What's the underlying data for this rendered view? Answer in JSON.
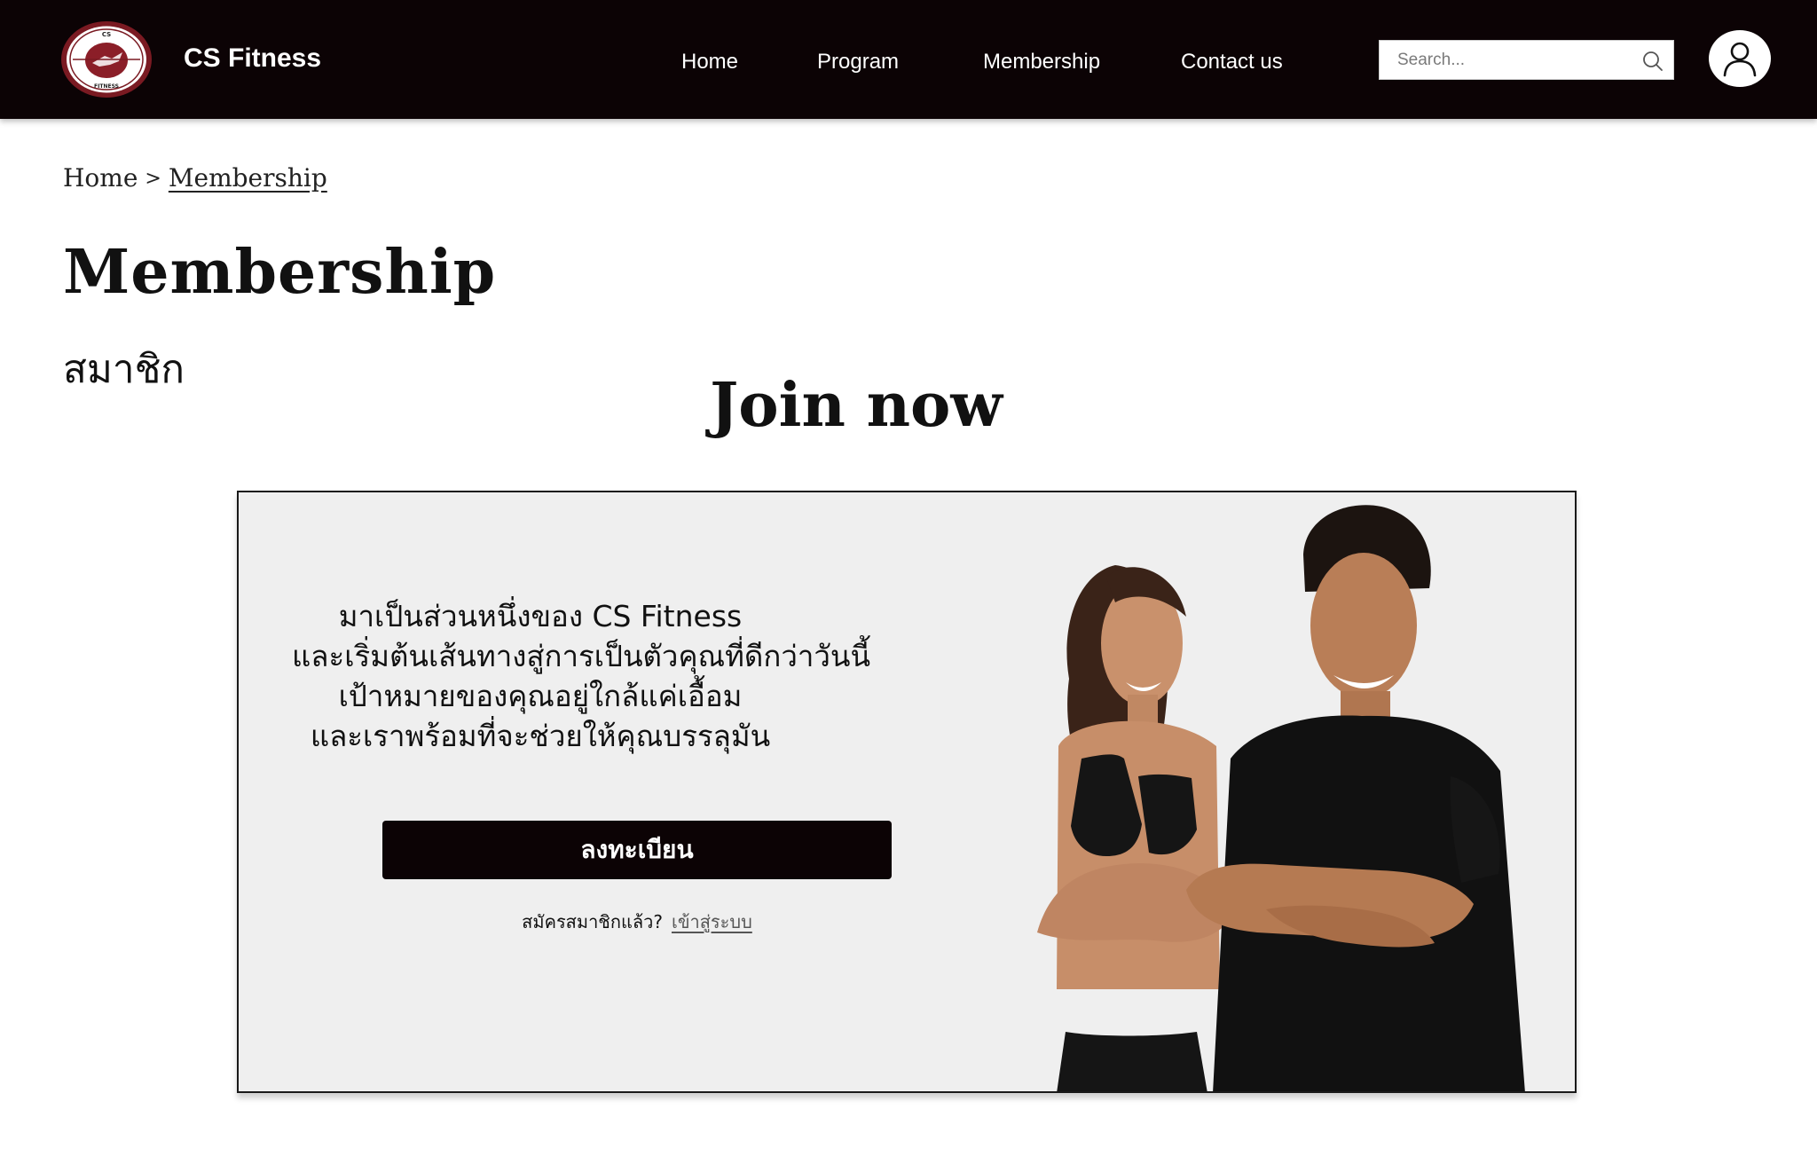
{
  "header": {
    "brand": "CS Fitness",
    "logo_text_top": "CS",
    "logo_text_bottom": "FITNESS",
    "nav": [
      "Home",
      "Program",
      "Membership",
      "Contact us"
    ],
    "search_placeholder": "Search...",
    "colors": {
      "bar": "#0c0305",
      "logo": "#7a1a22"
    }
  },
  "breadcrumb": {
    "home": "Home",
    "separator": ">",
    "current": "Membership"
  },
  "page": {
    "title": "Membership",
    "subtitle": "สมาชิก",
    "join_title": "Join now"
  },
  "card": {
    "intro_lines": [
      "มาเป็นส่วนหนึ่งของ CS Fitness",
      "และเริ่มต้นเส้นทางสู่การเป็นตัวคุณที่ดีกว่าวันนี้",
      "เป้าหมายของคุณอยู่ใกล้แค่เอื้อม",
      "และเราพร้อมที่จะช่วยให้คุณบรรลุมัน"
    ],
    "signup_label": "ลงทะเบียน",
    "login_prompt": "สมัครสมาชิกแล้ว?",
    "login_link": "เข้าสู่ระบบ"
  },
  "icons": [
    "logo-icon",
    "search-icon",
    "user-icon"
  ]
}
